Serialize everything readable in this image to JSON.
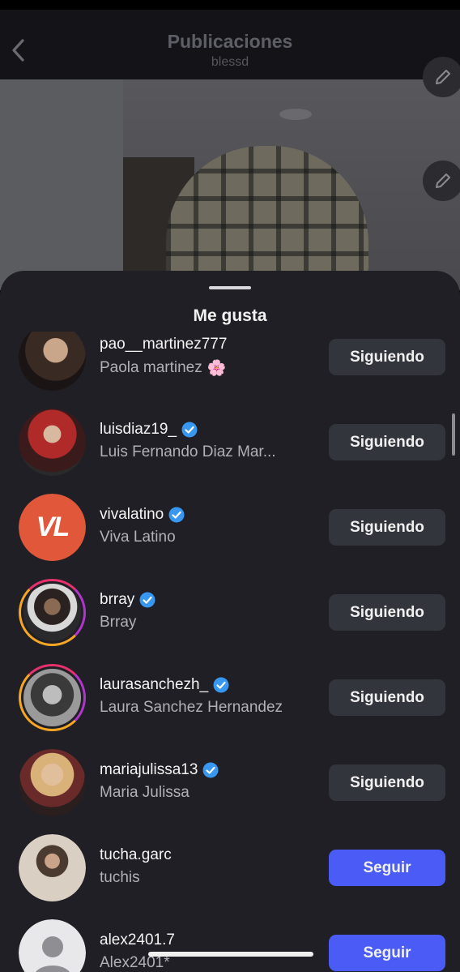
{
  "header": {
    "title": "Publicaciones",
    "subtitle": "blessd",
    "back_icon": "chevron-left-icon",
    "edit_icon": "pencil-icon"
  },
  "sheet": {
    "title": "Me gusta"
  },
  "colors": {
    "sheet_bg": "#1f1f25",
    "following_button": "#33353c",
    "follow_button": "#4a5cf5",
    "verified_badge": "#3897f0"
  },
  "likes": [
    {
      "username": "pao__martinez777",
      "name": "Paola martinez",
      "emoji": "🌸",
      "verified": false,
      "button": "Siguiendo",
      "state": "following"
    },
    {
      "username": "luisdiaz19_",
      "name": "Luis Fernando Diaz Mar...",
      "verified": true,
      "button": "Siguiendo",
      "state": "following"
    },
    {
      "username": "vivalatino",
      "name": "Viva Latino",
      "verified": true,
      "button": "Siguiendo",
      "state": "following",
      "avatar_text": "VL"
    },
    {
      "username": "brray",
      "name": "Brray",
      "verified": true,
      "button": "Siguiendo",
      "state": "following",
      "story_ring": true
    },
    {
      "username": "laurasanchezh_",
      "name": "Laura Sanchez Hernandez",
      "verified": true,
      "button": "Siguiendo",
      "state": "following",
      "story_ring": true
    },
    {
      "username": "mariajulissa13",
      "name": "Maria Julissa",
      "verified": true,
      "button": "Siguiendo",
      "state": "following"
    },
    {
      "username": "tucha.garc",
      "name": "tuchis",
      "verified": false,
      "button": "Seguir",
      "state": "follow"
    },
    {
      "username": "alex2401.7",
      "name": "Alex2401*",
      "verified": false,
      "button": "Seguir",
      "state": "follow"
    }
  ]
}
